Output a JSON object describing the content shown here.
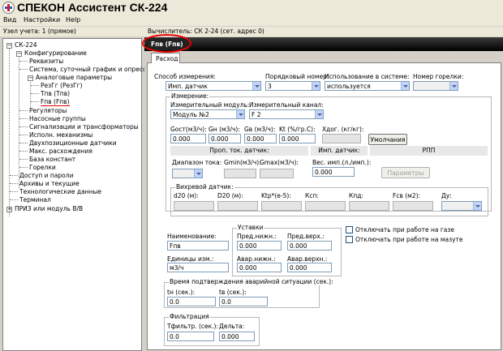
{
  "app": {
    "title": "СПЕКОН Ассистент СК-224"
  },
  "menu": [
    "Вид",
    "Настройки",
    "Help"
  ],
  "status": {
    "node": "Узел учета: 1 (прямое)",
    "computer": "Вычислитель: СК 2-24 (сет. адрес 0)"
  },
  "tree": {
    "root": "СК-224",
    "configure": "Конфигурирование",
    "items_a": [
      "Реквизиты",
      "Система, суточный график и опрессовка"
    ],
    "analog": "Аналоговые параметры",
    "analog_items": [
      "РезГг (РезГг)",
      "Тпв (Тпв)",
      "Fпв (Fпв)"
    ],
    "items_b": [
      "Регуляторы",
      "Насосные группы",
      "Сигнализации и трансформаторы",
      "Исполн. механизмы",
      "Двухпозиционные датчики",
      "Макс. расхождения",
      "База констант",
      "Горелки"
    ],
    "items_c": [
      "Доступ и пароли",
      "Архивы и текущие",
      "Технологические данные",
      "Терминал"
    ],
    "last": "ПРИЗ или модуль В/В"
  },
  "header": {
    "tab_title": "Fпв (Fпв)"
  },
  "tabs": [
    "Расход"
  ],
  "form": {
    "method_label": "Способ измерения:",
    "method_value": "Имп. датчик",
    "order_label": "Порядковый номер:",
    "order_value": "3",
    "use_label": "Использование в системе:",
    "use_value": "используется",
    "burner_label": "Номер горелки:",
    "burner_value": "",
    "measure_group": "Измерение:",
    "module_label": "Измерительный модуль:",
    "module_value": "Модуль №2",
    "channel_label": "Измерительный канал:",
    "channel_value": "F 2",
    "gost_label": "Gост(м3/ч):",
    "gost_value": "0.000",
    "gn_label": "Gн (м3/ч):",
    "gn_value": "0.000",
    "gv_label": "Gв (м3/ч):",
    "gv_value": "0.000",
    "kt_label": "Kt (%/гр.С):",
    "kt_value": "0.000",
    "xdog_label": "Хдог. (кг/кг):",
    "xdog_value": "",
    "defaults_button": "Умолчания",
    "prop_header": "Проп. ток. датчик:",
    "imp_header": "Имп. датчик:",
    "rpp_header": "РПП",
    "range_label": "Диапазон тока:",
    "range_value": "",
    "gmin_label": "Gmin(м3/ч):",
    "gmin_value": "",
    "gmax_label": "Gmax(м3/ч):",
    "gmax_value": "",
    "weight_label": "Вес. имп.(л./имп.):",
    "weight_value": "0.000",
    "params_button": "Параметры",
    "vortex_group": "Вихревой датчик:",
    "vortex_labels": [
      "d20 (м):",
      "D20 (м):",
      "Ktp*(е-5):",
      "Ксп:",
      "Кпд:",
      "Fсв (м2):",
      "Ду:"
    ],
    "name_label": "Наименование:",
    "name_value": "Fпв",
    "unit_label": "Единицы изм.:",
    "unit_value": "м3/ч",
    "settings_group": "Уставки",
    "pred_low_label": "Пред.нижн.:",
    "pred_low_value": "0.000",
    "pred_high_label": "Пред.верх.:",
    "pred_high_value": "0.000",
    "alarm_low_label": "Авар.нижн.:",
    "alarm_low_value": "0.000",
    "alarm_high_label": "Авар.верхн.:",
    "alarm_high_value": "0.000",
    "gas_check": "Отключать при работе на газе",
    "mazut_check": "Отключать при работе на мазуте",
    "confirm_group": "Время подтверждения аварийной ситуации (сек.):",
    "tn_label": "tн (сек.):",
    "tn_value": "0.0",
    "tv_label": "tв (сек.):",
    "tv_value": "0.0",
    "filter_group": "Фильтрация",
    "tfilter_label": "Тфильтр. (сек.):",
    "tfilter_value": "0.0",
    "delta_label": "Дельта:",
    "delta_value": "0.000"
  },
  "colors": {
    "title_bar": "#ece9d8",
    "highlight": "#e00000",
    "dark_bar": "#000000"
  }
}
